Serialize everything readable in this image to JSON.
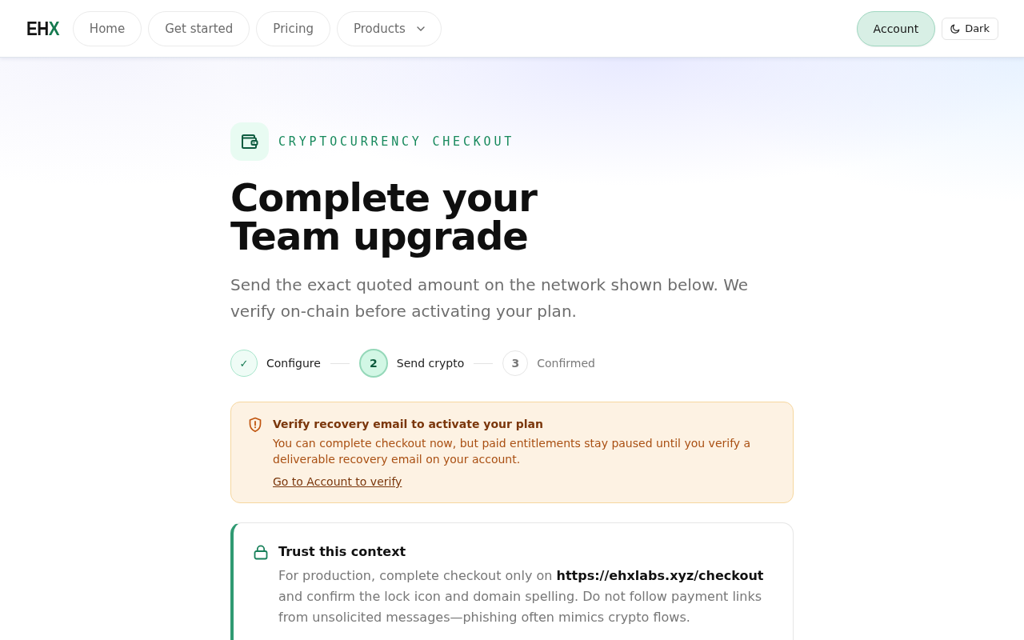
{
  "header": {
    "logo": {
      "text": "EH",
      "accent": "X"
    },
    "nav": [
      {
        "label": "Home",
        "kind": "link"
      },
      {
        "label": "Get started",
        "kind": "link"
      },
      {
        "label": "Pricing",
        "kind": "link"
      },
      {
        "label": "Products",
        "kind": "menu"
      }
    ],
    "account_button": "Account",
    "theme_toggle": "Dark"
  },
  "hero": {
    "kicker": "CRYPTOCURRENCY CHECKOUT",
    "title": "Complete your Team upgrade",
    "subtitle": "Send the exact quoted amount on the network shown below. We verify on-chain before activating your plan."
  },
  "steps": [
    {
      "marker": "✓",
      "label": "Configure",
      "done": true,
      "selected": false
    },
    {
      "marker": "2",
      "label": "Send crypto",
      "done": false,
      "selected": true
    },
    {
      "marker": "3",
      "label": "Confirmed",
      "done": false,
      "selected": false
    }
  ],
  "alert": {
    "title": "Verify recovery email to activate your plan",
    "message": "You can complete checkout now, but paid entitlements stay paused until you verify a deliverable recovery email on your account.",
    "link": "Go to Account to verify"
  },
  "trust_card": {
    "title": "Trust this context",
    "body": "For production, complete checkout only on **https://ehxlabs.xyz/checkout** and confirm the lock icon and domain spelling. Do not follow payment links from unsolicited messages—phishing often mimics crypto flows."
  }
}
